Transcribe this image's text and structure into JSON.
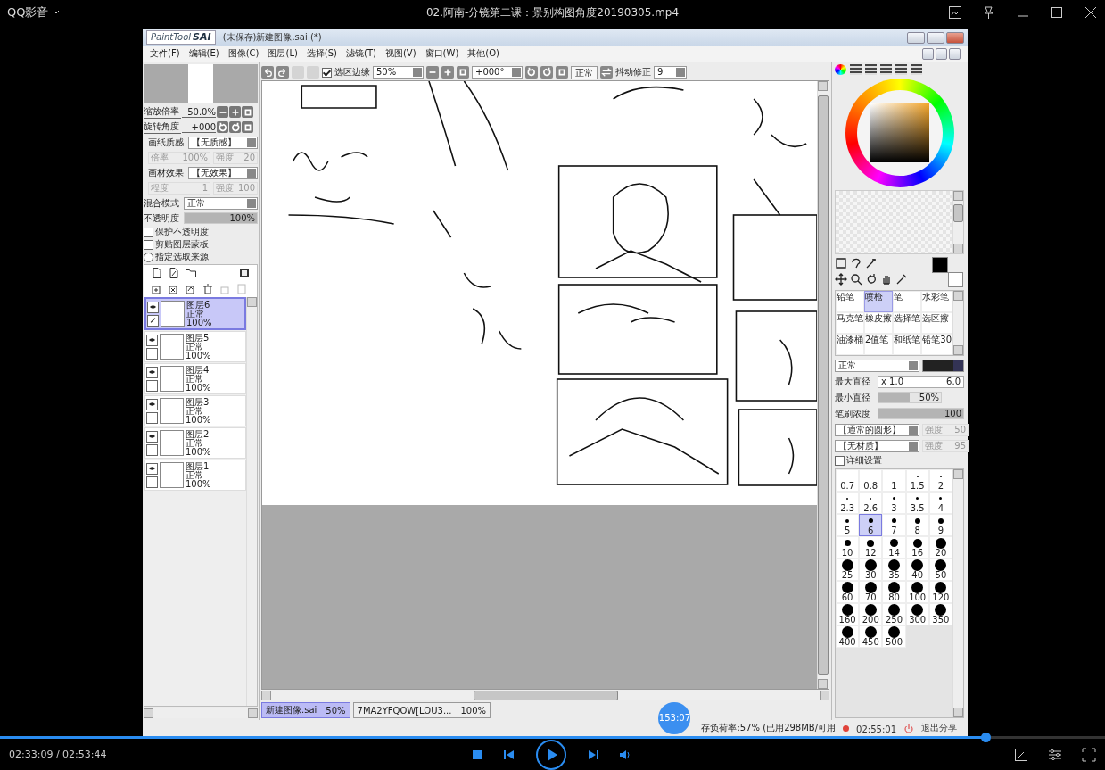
{
  "player": {
    "app_name": "QQ影音",
    "title": "02.阿南-分镜第二课：景别构图角度20190305.mp4",
    "time": "02:33:09 / 02:53:44",
    "progress": {
      "level": 0.892
    }
  },
  "sai": {
    "logo_small": "PaintTool",
    "logo_big": "SAI",
    "title": "(未保存)新建图像.sai (*)",
    "menu": [
      "文件(F)",
      "编辑(E)",
      "图像(C)",
      "图层(L)",
      "选择(S)",
      "滤镜(T)",
      "视图(V)",
      "窗口(W)",
      "其他(O)"
    ],
    "toolbar": {
      "selection_edge": {
        "label": "选区边缘",
        "checked": true
      },
      "zoom": "50%",
      "angle": "+000°",
      "mode": "正常",
      "stabilizer_label": "抖动修正",
      "stabilizer": "9"
    },
    "navigator": {
      "zoom_label": "缩放倍率",
      "zoom": "50.0%",
      "rotate_label": "旋转角度",
      "rotate": "+000"
    },
    "textures": [
      {
        "label": "画纸质感",
        "value": "【无质感】",
        "sub_label_1": "倍率",
        "sub_value_1": "100%",
        "sub_label_2": "强度",
        "sub_value_2": "20"
      },
      {
        "label": "画材效果",
        "value": "【无效果】",
        "sub_label_1": "程度",
        "sub_value_1": "1",
        "sub_label_2": "强度",
        "sub_value_2": "100"
      }
    ],
    "blend_label": "混合模式",
    "blend": "正常",
    "opacity_label": "不透明度",
    "opacity": {
      "reading": "100%",
      "level": 1
    },
    "options": [
      {
        "kind": "checkbox",
        "label": "保护不透明度",
        "checked": false
      },
      {
        "kind": "checkbox",
        "label": "剪贴图层蒙板",
        "checked": false
      },
      {
        "kind": "radio",
        "label": "指定选取来源",
        "checked": false
      }
    ],
    "layers": [
      {
        "name": "图层6",
        "mode": "正常",
        "opacity": "100%",
        "visible": true,
        "selected": true
      },
      {
        "name": "图层5",
        "mode": "正常",
        "opacity": "100%",
        "visible": true,
        "selected": false
      },
      {
        "name": "图层4",
        "mode": "正常",
        "opacity": "100%",
        "visible": true,
        "selected": false
      },
      {
        "name": "图层3",
        "mode": "正常",
        "opacity": "100%",
        "visible": true,
        "selected": false
      },
      {
        "name": "图层2",
        "mode": "正常",
        "opacity": "100%",
        "visible": true,
        "selected": false
      },
      {
        "name": "图层1",
        "mode": "正常",
        "opacity": "100%",
        "visible": true,
        "selected": false
      }
    ],
    "tools": [
      {
        "label": "铅笔",
        "selected": false
      },
      {
        "label": "喷枪",
        "selected": true
      },
      {
        "label": "笔",
        "selected": false
      },
      {
        "label": "水彩笔",
        "selected": false
      },
      {
        "label": "马克笔",
        "selected": false
      },
      {
        "label": "橡皮擦",
        "selected": false
      },
      {
        "label": "选择笔",
        "selected": false
      },
      {
        "label": "选区擦",
        "selected": false
      },
      {
        "label": "油漆桶",
        "selected": false
      },
      {
        "label": "2值笔",
        "selected": false
      },
      {
        "label": "和纸笔",
        "selected": false
      },
      {
        "label": "铅笔30",
        "selected": false
      }
    ],
    "brush_mode": "正常",
    "max_size": {
      "label": "最大直径",
      "factor": "x 1.0",
      "reading": "6.0"
    },
    "min_size": {
      "label": "最小直径",
      "reading": "50%",
      "level": 0.5
    },
    "density": {
      "label": "笔刷浓度",
      "reading": "100",
      "level": 1
    },
    "shapes": [
      {
        "value": "【通常的圆形】",
        "strength_label": "强度",
        "strength": "50"
      },
      {
        "value": "【无材质】",
        "strength_label": "强度",
        "strength": "95"
      }
    ],
    "detail": {
      "label": "详细设置",
      "checked": false
    },
    "sizes": [
      {
        "label": "0.7",
        "selected": false
      },
      {
        "label": "0.8",
        "selected": false
      },
      {
        "label": "1",
        "selected": false
      },
      {
        "label": "1.5",
        "selected": false
      },
      {
        "label": "2",
        "selected": false
      },
      {
        "label": "2.3",
        "selected": false
      },
      {
        "label": "2.6",
        "selected": false
      },
      {
        "label": "3",
        "selected": false
      },
      {
        "label": "3.5",
        "selected": false
      },
      {
        "label": "4",
        "selected": false
      },
      {
        "label": "5",
        "selected": false
      },
      {
        "label": "6",
        "selected": true
      },
      {
        "label": "7",
        "selected": false
      },
      {
        "label": "8",
        "selected": false
      },
      {
        "label": "9",
        "selected": false
      },
      {
        "label": "10",
        "selected": false
      },
      {
        "label": "12",
        "selected": false
      },
      {
        "label": "14",
        "selected": false
      },
      {
        "label": "16",
        "selected": false
      },
      {
        "label": "20",
        "selected": false
      },
      {
        "label": "25",
        "selected": false
      },
      {
        "label": "30",
        "selected": false
      },
      {
        "label": "35",
        "selected": false
      },
      {
        "label": "40",
        "selected": false
      },
      {
        "label": "50",
        "selected": false
      },
      {
        "label": "60",
        "selected": false
      },
      {
        "label": "70",
        "selected": false
      },
      {
        "label": "80",
        "selected": false
      },
      {
        "label": "100",
        "selected": false
      },
      {
        "label": "120",
        "selected": false
      },
      {
        "label": "160",
        "selected": false
      },
      {
        "label": "200",
        "selected": false
      },
      {
        "label": "250",
        "selected": false
      },
      {
        "label": "300",
        "selected": false
      },
      {
        "label": "350",
        "selected": false
      },
      {
        "label": "400",
        "selected": false
      },
      {
        "label": "450",
        "selected": false
      },
      {
        "label": "500",
        "selected": false
      }
    ],
    "documents": [
      {
        "name": "新建图像.sai",
        "zoom": "50%",
        "selected": true
      },
      {
        "name": "7MA2YFQOW[LOU3...",
        "zoom": "100%",
        "selected": false
      }
    ],
    "status": {
      "memory": "存负荷率:57% (已用298MB/可用",
      "bubble": "153:07",
      "time": "02:55:01",
      "exit_share": "退出分享"
    }
  }
}
